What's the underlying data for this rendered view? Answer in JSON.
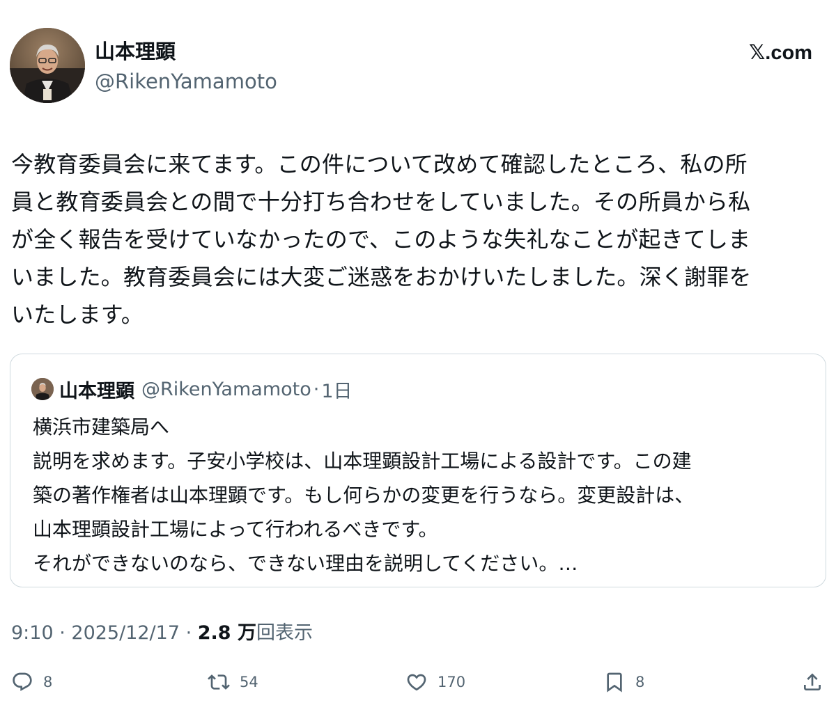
{
  "brand": "𝕏.com",
  "author": {
    "name": "山本理顕",
    "handle": "@RikenYamamoto"
  },
  "tweet": {
    "lines": [
      "今教育委員会に来てます。この件について改めて確認したところ、私の所",
      "員と教育委員会との間で十分打ち合わせをしていました。その所員から私",
      "が全く報告を受けていなかったので、このような失礼なことが起きてしま",
      "いました。教育委員会には大変ご迷惑をおかけいたしました。深く謝罪を",
      "いたします。"
    ]
  },
  "quote": {
    "name": "山本理顕",
    "handle": "@RikenYamamoto",
    "separator": "·",
    "time": "1日",
    "lines": [
      "横浜市建築局へ",
      "説明を求めます。子安小学校は、山本理顕設計工場による設計です。この建",
      "築の著作権者は山本理顕です。もし何らかの変更を行うなら。変更設計は、",
      "山本理顕設計工場によって行われるべきです。",
      "それができないのなら、できない理由を説明してください。…"
    ]
  },
  "meta": {
    "time": "9:10",
    "separator1": " · ",
    "date": "2025/12/17",
    "separator2": " · ",
    "views_count": "2.8 万",
    "views_label": "回表示"
  },
  "actions": {
    "replies": {
      "count": "8",
      "icon": "reply-icon"
    },
    "reposts": {
      "count": "54",
      "icon": "repost-icon"
    },
    "likes": {
      "count": "170",
      "icon": "heart-icon"
    },
    "bookmarks": {
      "count": "8",
      "icon": "bookmark-icon"
    },
    "share": {
      "icon": "share-icon"
    }
  },
  "colors": {
    "text": "#0f1419",
    "secondary": "#536471",
    "border": "#cfd9de"
  }
}
